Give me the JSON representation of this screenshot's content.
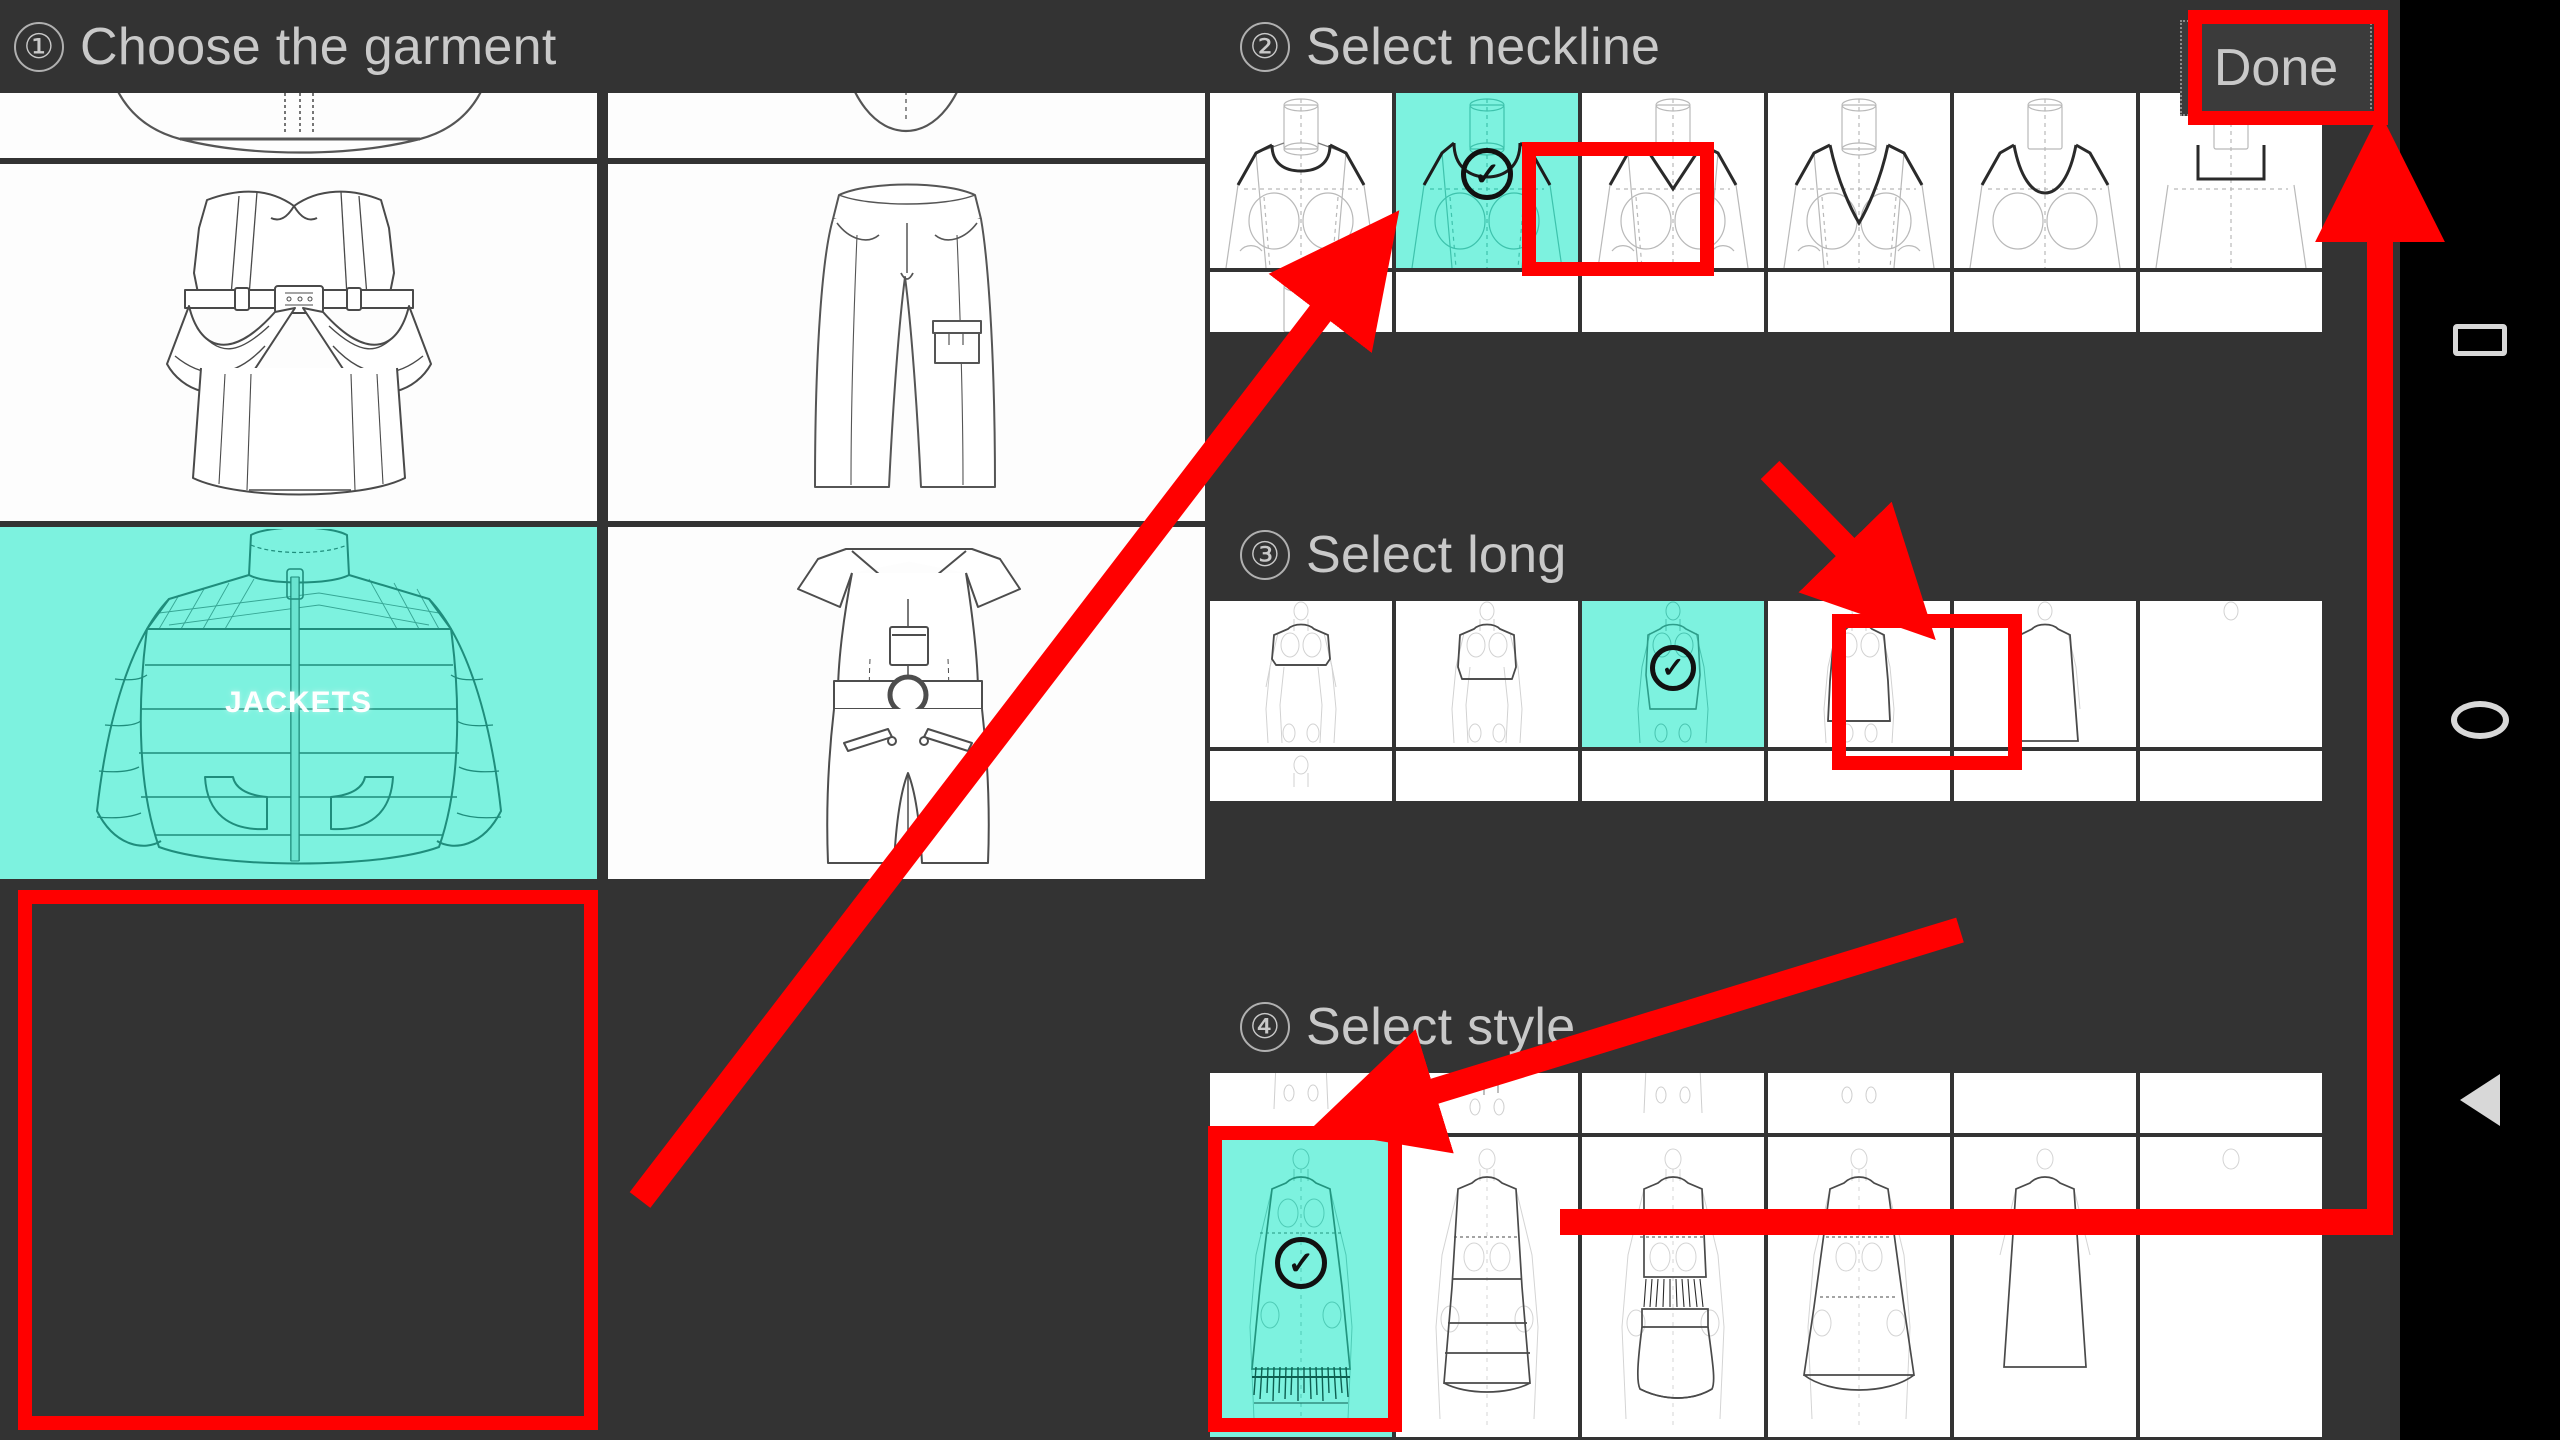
{
  "app": {
    "background_color": "#333333",
    "panel_color": "#ffffff",
    "selection_color": "#7df2df",
    "annotation_color": "#ff0000",
    "text_color": "#c9c9c9"
  },
  "steps": [
    {
      "number": "①",
      "title": "Choose the garment"
    },
    {
      "number": "②",
      "title": "Select neckline"
    },
    {
      "number": "③",
      "title": "Select long"
    },
    {
      "number": "④",
      "title": "Select style"
    }
  ],
  "toolbar": {
    "done_label": "Done"
  },
  "garment_grid": {
    "rows": [
      [
        {
          "name": "skirt-partial",
          "selected": false,
          "label": ""
        },
        {
          "name": "top-partial",
          "selected": false,
          "label": ""
        }
      ],
      [
        {
          "name": "bustier-dress",
          "selected": false,
          "label": ""
        },
        {
          "name": "cargo-pants",
          "selected": false,
          "label": ""
        }
      ],
      [
        {
          "name": "jackets",
          "selected": true,
          "label": "JACKETS"
        },
        {
          "name": "playsuit",
          "selected": false,
          "label": ""
        }
      ]
    ]
  },
  "neckline_row": {
    "tiles": [
      {
        "name": "round-neck",
        "selected": false,
        "checked": false
      },
      {
        "name": "scoop-neck",
        "selected": true,
        "checked": true
      },
      {
        "name": "v-neck-shallow",
        "selected": false,
        "checked": false
      },
      {
        "name": "v-neck-deep",
        "selected": false,
        "checked": false
      },
      {
        "name": "neckline-5",
        "selected": false,
        "checked": false
      },
      {
        "name": "neckline-6",
        "selected": false,
        "checked": false
      }
    ],
    "next_row_partial": 6
  },
  "long_row": {
    "tiles": [
      {
        "name": "crop-length",
        "selected": false,
        "checked": false
      },
      {
        "name": "hip-length",
        "selected": false,
        "checked": false
      },
      {
        "name": "knee-length",
        "selected": true,
        "checked": true
      },
      {
        "name": "midi-length",
        "selected": false,
        "checked": false
      },
      {
        "name": "long-5",
        "selected": false,
        "checked": false
      },
      {
        "name": "long-6",
        "selected": false,
        "checked": false
      }
    ],
    "next_row_partial": 6
  },
  "style_row": {
    "tiles": [
      {
        "name": "fringe-hem",
        "selected": true,
        "checked": true
      },
      {
        "name": "tiered-dress",
        "selected": false,
        "checked": false
      },
      {
        "name": "gathered-waist",
        "selected": false,
        "checked": false
      },
      {
        "name": "a-line-dress",
        "selected": false,
        "checked": false
      },
      {
        "name": "style-5",
        "selected": false,
        "checked": false
      },
      {
        "name": "style-6",
        "selected": false,
        "checked": false
      }
    ],
    "prev_row_partial": 6
  },
  "navbar": {
    "buttons": [
      {
        "name": "recents-button",
        "icon": "square-icon"
      },
      {
        "name": "home-button",
        "icon": "circle-icon"
      },
      {
        "name": "back-button",
        "icon": "triangle-left-icon"
      }
    ]
  },
  "annotations": {
    "highlight_boxes": [
      {
        "name": "jackets-highlight",
        "target": "garment-jackets"
      },
      {
        "name": "neckline-highlight",
        "target": "neckline-scoop"
      },
      {
        "name": "long-highlight",
        "target": "long-knee"
      },
      {
        "name": "style-highlight",
        "target": "style-fringe"
      },
      {
        "name": "done-highlight",
        "target": "done-button"
      }
    ],
    "arrows": [
      {
        "name": "arrow-jackets-to-neckline",
        "from": "jackets-tile",
        "to": "neckline-row"
      },
      {
        "name": "arrow-neckline-to-long",
        "from": "neckline-tile",
        "to": "long-row"
      },
      {
        "name": "arrow-long-to-style",
        "from": "long-tile",
        "to": "style-row"
      },
      {
        "name": "arrow-style-to-done",
        "from": "style-row",
        "to": "done-button"
      }
    ]
  },
  "tick_glyph": "✓"
}
